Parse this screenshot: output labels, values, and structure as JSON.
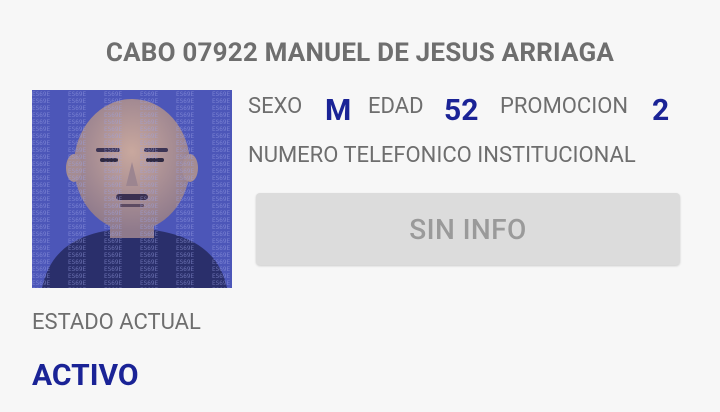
{
  "header": {
    "title": "CABO 07922 MANUEL DE JESUS ARRIAGA"
  },
  "profile": {
    "photo": "profile-photo",
    "photo_watermark": "ES69E",
    "sexo_label": "SEXO",
    "sexo_value": "M",
    "edad_label": "EDAD",
    "edad_value": "52",
    "promocion_label": "PROMOCION",
    "promocion_value": "2",
    "telefono_label": "NUMERO TELEFONICO INSTITUCIONAL",
    "telefono_button": "SIN INFO"
  },
  "estado": {
    "label": "ESTADO ACTUAL",
    "value": "ACTIVO"
  },
  "colors": {
    "background": "#f7f7f7",
    "label_gray": "#6e6e6e",
    "accent_blue": "#1a2396",
    "button_bg": "#dcdcdc",
    "button_text": "#9a9a9a"
  }
}
